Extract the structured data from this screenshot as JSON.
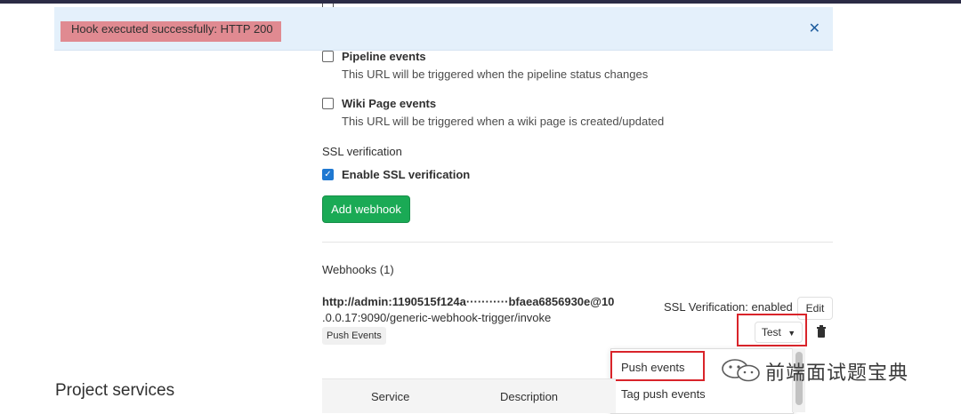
{
  "flash": {
    "message": "Hook executed successfully: HTTP 200"
  },
  "events": [
    {
      "title": "Pipeline events",
      "description": "This URL will be triggered when the pipeline status changes",
      "checked": false
    },
    {
      "title": "Wiki Page events",
      "description": "This URL will be triggered when a wiki page is created/updated",
      "checked": false
    }
  ],
  "ssl": {
    "section_label": "SSL verification",
    "option_label": "Enable SSL verification",
    "checked": true
  },
  "add_button": "Add webhook",
  "webhooks": {
    "heading": "Webhooks (1)",
    "item": {
      "url_line1": "http://admin:1190515f124a···········bfaea6856930e@10",
      "url_line2": ".0.0.17:9090/generic-webhook-trigger/invoke",
      "badge": "Push Events",
      "ssl_status": "SSL Verification: enabled",
      "edit_label": "Edit",
      "test_label": "Test"
    }
  },
  "dropdown": {
    "items": [
      "Push events",
      "Tag push events"
    ]
  },
  "project_services": {
    "title": "Project services",
    "columns": [
      "Service",
      "Description"
    ]
  },
  "watermark": {
    "text": "前端面试题宝典"
  }
}
